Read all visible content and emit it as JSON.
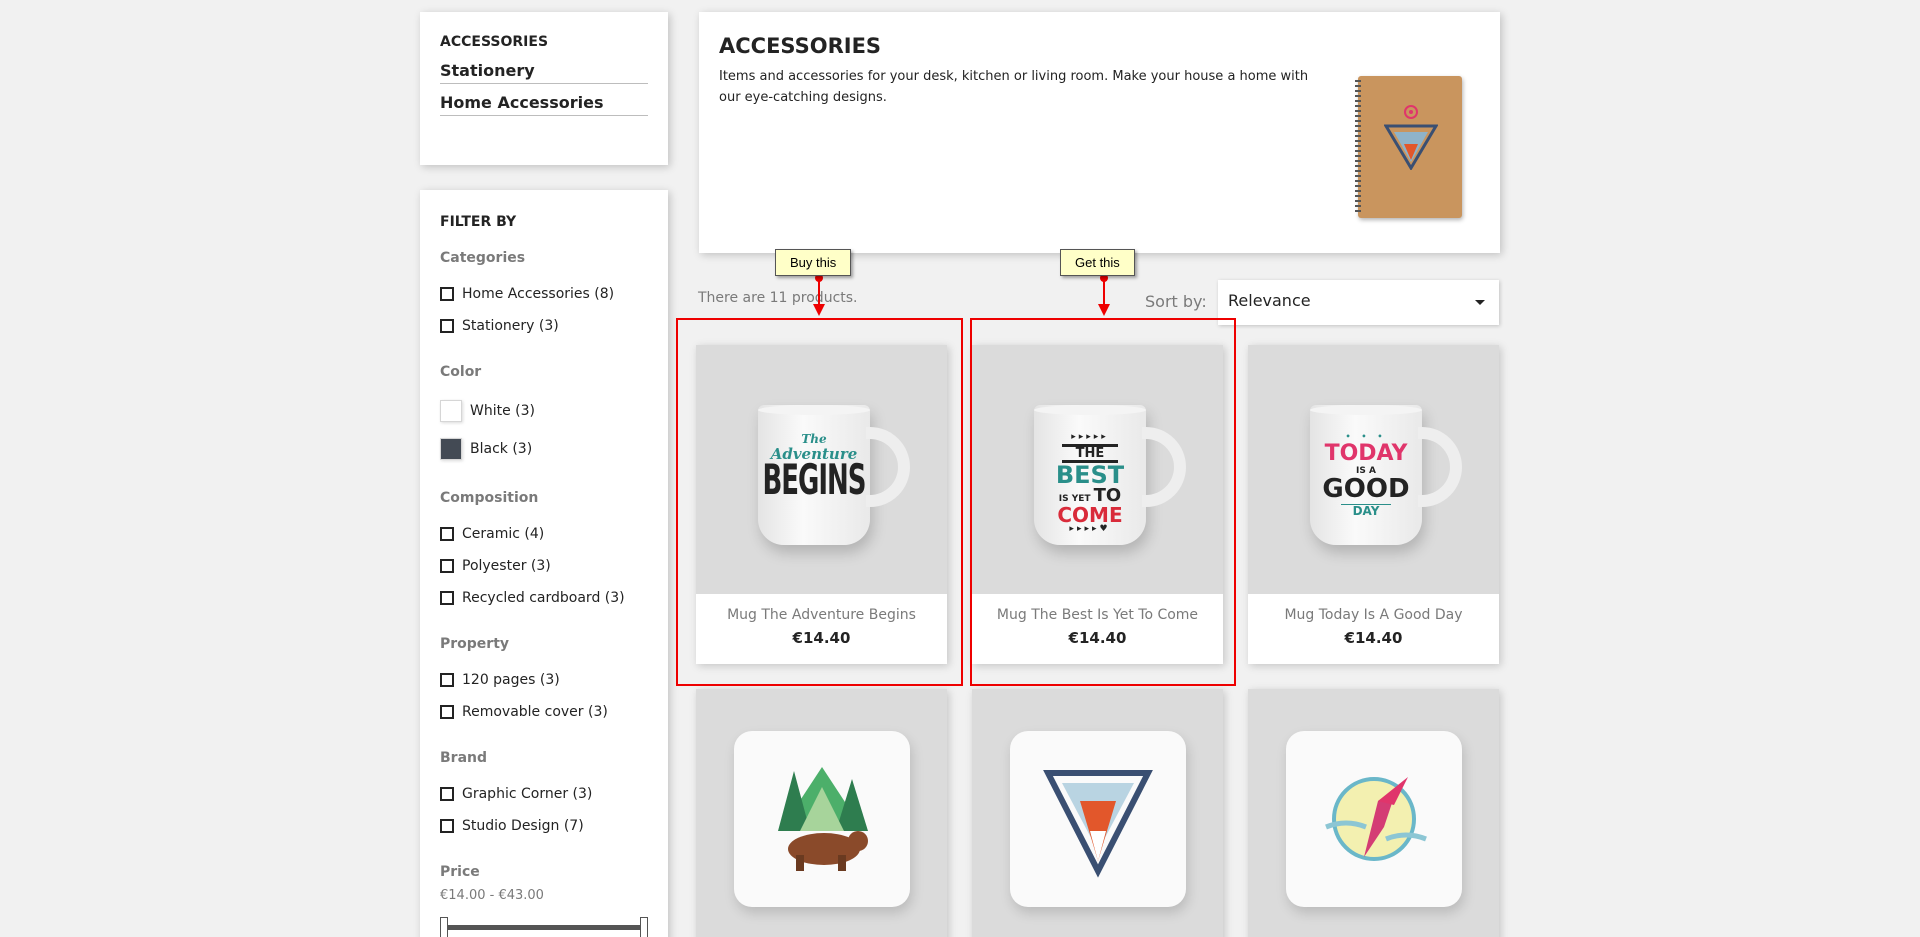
{
  "categories_block": {
    "title": "ACCESSORIES",
    "items": [
      {
        "label": "Stationery"
      },
      {
        "label": "Home Accessories"
      }
    ]
  },
  "filters": {
    "title": "FILTER BY",
    "categories": {
      "title": "Categories",
      "items": [
        "Home Accessories (8)",
        "Stationery (3)"
      ]
    },
    "color": {
      "title": "Color",
      "items": [
        {
          "label": "White (3)",
          "swatch": "#ffffff"
        },
        {
          "label": "Black (3)",
          "swatch": "#434a54"
        }
      ]
    },
    "composition": {
      "title": "Composition",
      "items": [
        "Ceramic (4)",
        "Polyester (3)",
        "Recycled cardboard (3)"
      ]
    },
    "property": {
      "title": "Property",
      "items": [
        "120 pages (3)",
        "Removable cover (3)"
      ]
    },
    "brand": {
      "title": "Brand",
      "items": [
        "Graphic Corner (3)",
        "Studio Design (7)"
      ]
    },
    "price": {
      "title": "Price",
      "range": "€14.00 - €43.00"
    }
  },
  "header": {
    "title": "ACCESSORIES",
    "description": "Items and accessories for your desk, kitchen or living room. Make your house a home with our eye-catching designs."
  },
  "toolbar": {
    "count": "There are 11 products.",
    "sort_label": "Sort by:",
    "sort_value": "Relevance"
  },
  "products": [
    {
      "name": "Mug The Adventure Begins",
      "price": "€14.40"
    },
    {
      "name": "Mug The Best Is Yet To Come",
      "price": "€14.40"
    },
    {
      "name": "Mug Today Is A Good Day",
      "price": "€14.40"
    }
  ],
  "mug_art": {
    "mug1": [
      "The",
      "Adventure",
      "BEGINS"
    ],
    "mug2": [
      "THE",
      "BEST",
      "IS YET",
      "TO",
      "COME"
    ],
    "mug3": [
      "TODAY",
      "IS A",
      "GOOD",
      "DAY"
    ]
  },
  "annotations": [
    {
      "label": "Buy this"
    },
    {
      "label": "Get this"
    }
  ],
  "colors": {
    "accent_red": "#e00000",
    "tooltip_bg": "#ffffc8",
    "teal": "#2a8f8a",
    "pink": "#e0356b"
  }
}
